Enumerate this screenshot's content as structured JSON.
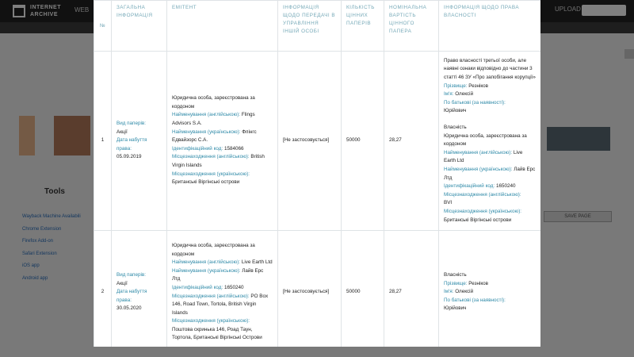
{
  "background": {
    "logo": [
      "INTERNET",
      "ARCHIVE"
    ],
    "nav_label": "WEB",
    "upload_label": "UPLOAD",
    "tools_title": "Tools",
    "tools_links": [
      "Wayback Machine Availabili",
      "Chrome Extension",
      "Firefox Add-on",
      "Safari Extension",
      "iOS app",
      "Android app"
    ],
    "save_page_button": "SAVE PAGE"
  },
  "table": {
    "headers": {
      "num": "№",
      "general": "ЗАГАЛЬНА ІНФОРМАЦІЯ",
      "issuer": "ЕМІТЕНТ",
      "transfer": "ІНФОРМАЦІЯ ЩОДО ПЕРЕДАЧІ В УПРАВЛІННЯ ІНШІЙ ОСОБІ",
      "count": "КІЛЬКІСТЬ ЦІННИХ ПАПЕРІВ",
      "nominal": "НОМІНАЛЬНА ВАРТІСТЬ ЦІННОГО ПАПЕРА",
      "ownership": "ІНФОРМАЦІЯ ЩОДО ПРАВА ВЛАСНОСТІ"
    },
    "rows": [
      {
        "num": "1",
        "general": {
          "type_label": "Вид паперів:",
          "type_value": "Акції",
          "date_label": "Дата набуття права:",
          "date_value": "05.09.2019"
        },
        "issuer": {
          "kind": "Юридична особа, зареєстрована за кордоном",
          "name_en_label": "Найменування (англійською):",
          "name_en_value": "Flings Advisors S.A.",
          "name_uk_label": "Найменування (українською):",
          "name_uk_value": "Флінгс Едвайзорс С.А.",
          "id_label": "Ідентифікаційний код:",
          "id_value": "1584066",
          "loc_en_label": "Місцезнаходження (англійською):",
          "loc_en_value": "British Virgin Islands",
          "loc_uk_label": "Місцезнаходження (українською):",
          "loc_uk_value": "Британські Віргінські острови"
        },
        "transfer": "[Не застосовується]",
        "count": "50000",
        "nominal": "28,27",
        "ownership": {
          "third_party": "Право власності третьої особи, але наявні ознаки відповідно до частини 3 статті 46 ЗУ «Про запобігання корупції»",
          "surname_label": "Прізвище:",
          "surname_value": "Резніков",
          "name_label": "Ім'я:",
          "name_value": "Олексій",
          "patronymic_label": "По батькові (за наявності):",
          "patronymic_value": "Юрійович",
          "ownership_title": "Власність",
          "kind": "Юридична особа, зареєстрована за кордоном",
          "name_en_label": "Найменування (англійською):",
          "name_en_value": "Live Earth Ltd",
          "name_uk_label": "Найменування (українською):",
          "name_uk_value": "Лайв Ерс Лтд",
          "id_label": "Ідентифікаційний код:",
          "id_value": "1650240",
          "loc_en_label": "Місцезнаходження (англійською):",
          "loc_en_value": "BVI",
          "loc_uk_label": "Місцезнаходження (українською):",
          "loc_uk_value": "Британські Віргінські острови"
        }
      },
      {
        "num": "2",
        "general": {
          "type_label": "Вид паперів:",
          "type_value": "Акції",
          "date_label": "Дата набуття права:",
          "date_value": "30.05.2020"
        },
        "issuer": {
          "kind": "Юридична особа, зареєстрована за кордоном",
          "name_en_label": "Найменування (англійською):",
          "name_en_value": "Live Earth Ltd",
          "name_uk_label": "Найменування (українською):",
          "name_uk_value": "Лайв Ерс Лтд",
          "id_label": "Ідентифікаційний код:",
          "id_value": "1650240",
          "loc_en_label": "Місцезнаходження (англійською):",
          "loc_en_value": "PO Box 146, Road Town, Tortola, British Virgin Islands",
          "loc_uk_label": "Місцезнаходження (українською):",
          "loc_uk_value": "Поштова скринька 146, Роад Таун, Тортола, Британські Віргінські Острови"
        },
        "transfer": "[Не застосовується]",
        "count": "50000",
        "nominal": "28,27",
        "ownership": {
          "ownership_title": "Власність",
          "surname_label": "Прізвище:",
          "surname_value": "Резніков",
          "name_label": "Ім'я:",
          "name_value": "Олексій",
          "patronymic_label": "По батькові (за наявності):",
          "patronymic_value": "Юрійович"
        }
      }
    ]
  }
}
